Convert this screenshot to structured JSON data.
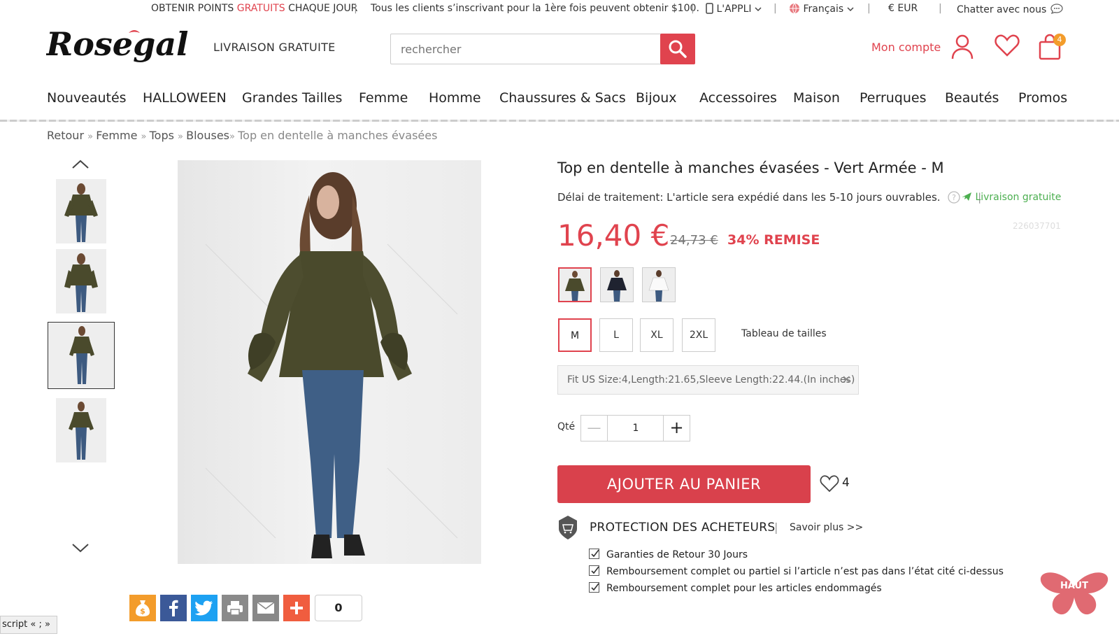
{
  "topbar": {
    "points_pre": "OBTENIR POINTS",
    "points_red": "GRATUITS",
    "points_post": "CHAQUE JOUR",
    "promo": "Tous les clients s’inscrivant pour la 1ère fois peuvent obtenir $100.",
    "app": "L'APPLI",
    "language": "Français",
    "currency": "€ EUR",
    "chat": "Chatter avec nous"
  },
  "header": {
    "logo_text": "Rosegal",
    "free_shipping": "LIVRAISON GRATUITE",
    "search_placeholder": "rechercher",
    "account_label": "Mon compte",
    "cart_count": "4"
  },
  "nav": [
    "Nouveautés",
    "HALLOWEEN",
    "Grandes Tailles",
    "Femme",
    "Homme",
    "Chaussures & Sacs",
    "Bijoux",
    "Accessoires",
    "Maison",
    "Perruques",
    "Beautés",
    "Promos"
  ],
  "breadcrumb": {
    "retour": "Retour",
    "femme": "Femme",
    "tops": "Tops",
    "blouses": "Blouses",
    "current": "Top en dentelle à manches évasées"
  },
  "product": {
    "title": "Top en dentelle à manches évasées - Vert Armée - M",
    "processing": "Délai de traitement: L'article sera expédié dans les 5-10 jours ouvrables.",
    "free_delivery": "Livraison gratuite",
    "sku": "226037701",
    "price": "16,40 €",
    "old_price": "24,73 €",
    "discount": "34% REMISE",
    "sizes": [
      "M",
      "L",
      "XL",
      "2XL"
    ],
    "selected_size": "M",
    "size_chart": "Tableau de tailles",
    "fit_info": "Fit US Size:4,Length:21.65,Sleeve Length:22.44.(In inches)",
    "qty_label": "Qté",
    "qty_value": "1",
    "add_to_cart": "AJOUTER AU PANIER",
    "wishlist_count": "4"
  },
  "protection": {
    "title": "PROTECTION DES ACHETEURS",
    "learn_more": "Savoir plus >>",
    "items": [
      "Garanties de Retour 30 Jours",
      "Remboursement complet ou partiel si l’article n’est pas dans l’état cité ci-dessus",
      "Remboursement complet pour les articles endommagés"
    ]
  },
  "share": {
    "count": "0"
  },
  "misc": {
    "script_tag": "script « ; »",
    "back_to_top": "HAUT"
  },
  "colors": {
    "accent": "#e0434e",
    "green": "#4caf50",
    "orange": "#f39c2b",
    "facebook": "#3b5998",
    "twitter": "#1da1f2"
  }
}
